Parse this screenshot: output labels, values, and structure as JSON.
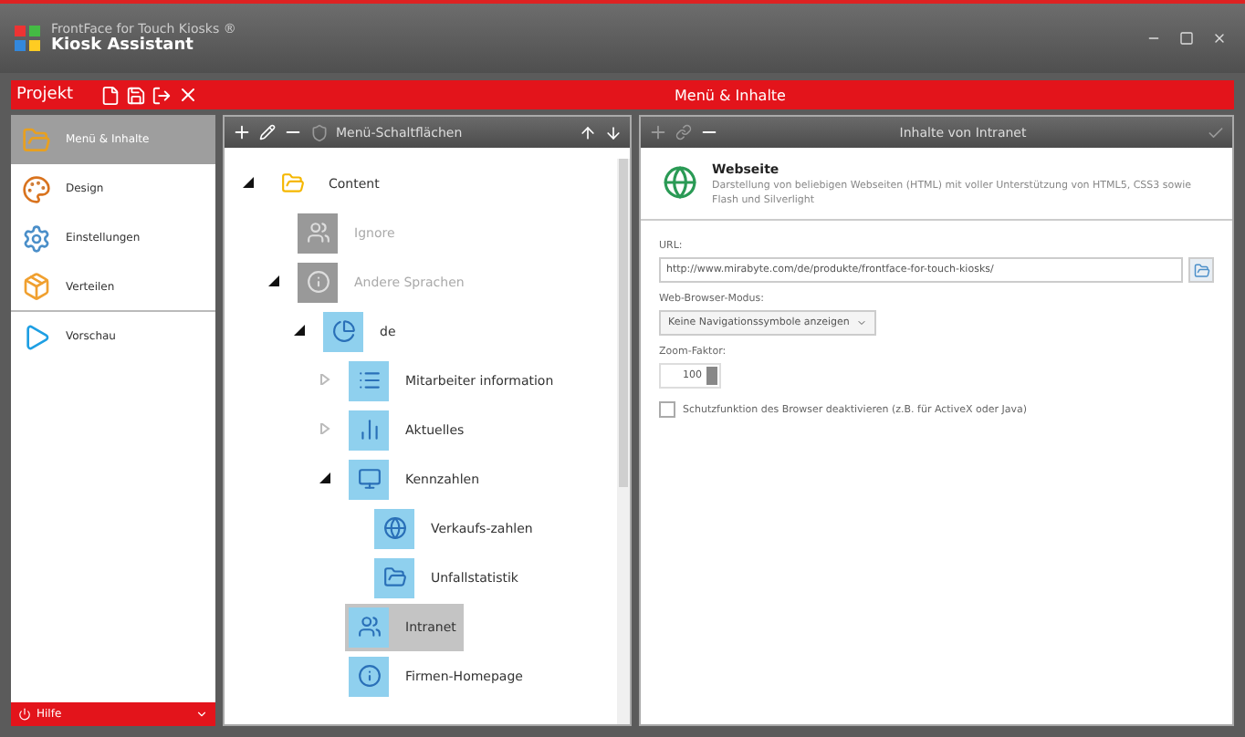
{
  "window": {
    "subtitle": "FrontFace for Touch Kiosks ®",
    "title": "Kiosk Assistant"
  },
  "project_bar": {
    "label": "Projekt",
    "heading": "Menü & Inhalte"
  },
  "sidebar": {
    "items": [
      {
        "label": "Menü & Inhalte",
        "selected": true
      },
      {
        "label": "Design",
        "selected": false
      },
      {
        "label": "Einstellungen",
        "selected": false
      },
      {
        "label": "Verteilen",
        "selected": false
      },
      {
        "label": "Vorschau",
        "selected": false
      }
    ],
    "help": "Hilfe"
  },
  "tree_panel": {
    "toolbar_label": "Menü-Schaltflächen",
    "nodes": [
      {
        "label": "Content",
        "expanded": true,
        "selected": false,
        "disabled": false,
        "children": [
          {
            "label": "Ignore",
            "selected": false,
            "disabled": true
          },
          {
            "label": "Andere Sprachen",
            "expanded": true,
            "selected": false,
            "disabled": true,
            "children": [
              {
                "label": "de",
                "expanded": true,
                "selected": false,
                "disabled": false,
                "children": [
                  {
                    "label": "Mitarbeiter information",
                    "expanded": false,
                    "selected": false,
                    "disabled": false
                  },
                  {
                    "label": "Aktuelles",
                    "expanded": false,
                    "selected": false,
                    "disabled": false
                  },
                  {
                    "label": "Kennzahlen",
                    "expanded": true,
                    "selected": false,
                    "disabled": false,
                    "children": [
                      {
                        "label": "Verkaufs-zahlen",
                        "selected": false,
                        "disabled": false
                      },
                      {
                        "label": "Unfallstatistik",
                        "selected": false,
                        "disabled": false
                      }
                    ]
                  },
                  {
                    "label": "Intranet",
                    "selected": true,
                    "disabled": false
                  },
                  {
                    "label": "Firmen-Homepage",
                    "selected": false,
                    "disabled": false
                  }
                ]
              }
            ]
          }
        ]
      }
    ]
  },
  "detail_panel": {
    "toolbar_label": "Inhalte von Intranet",
    "content_type": {
      "title": "Webseite",
      "description": "Darstellung von beliebigen Webseiten (HTML) mit voller Unterstützung von HTML5, CSS3 sowie Flash und Silverlight"
    },
    "url_label": "URL:",
    "url": "http://www.mirabyte.com/de/produkte/frontface-for-touch-kiosks/",
    "browser_mode_label": "Web-Browser-Modus:",
    "browser_mode": "Keine Navigationssymbole anzeigen",
    "zoom_label": "Zoom-Faktor:",
    "zoom": "100",
    "protection": {
      "label": "Schutzfunktion des Browser deaktivieren (z.B. für ActiveX oder Java)",
      "checked": false
    }
  }
}
